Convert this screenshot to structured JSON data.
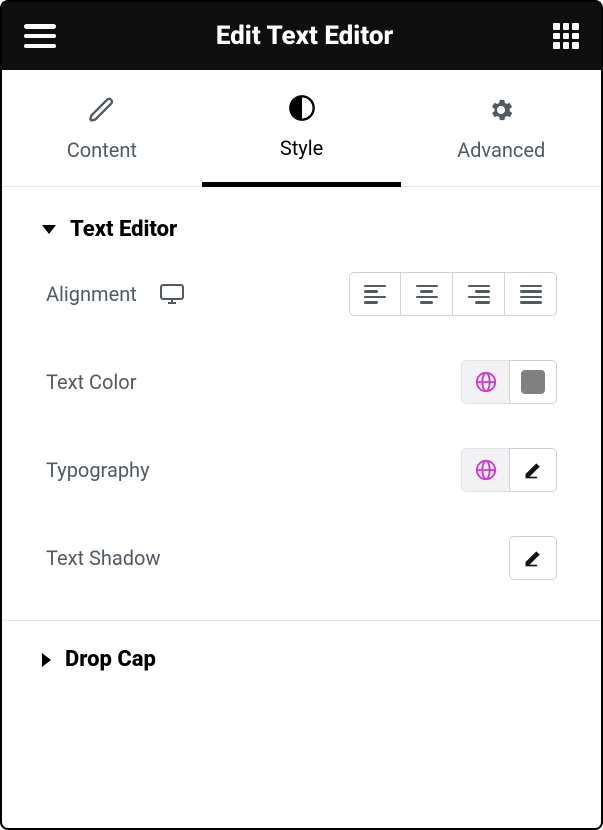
{
  "header": {
    "title": "Edit Text Editor"
  },
  "tabs": [
    {
      "label": "Content"
    },
    {
      "label": "Style"
    },
    {
      "label": "Advanced"
    }
  ],
  "active_tab": 1,
  "sections": {
    "text_editor": {
      "title": "Text Editor",
      "expanded": true,
      "controls": {
        "alignment": {
          "label": "Alignment"
        },
        "text_color": {
          "label": "Text Color",
          "swatch": "#808080",
          "global": true
        },
        "typography": {
          "label": "Typography",
          "global": true
        },
        "text_shadow": {
          "label": "Text Shadow"
        }
      }
    },
    "drop_cap": {
      "title": "Drop Cap",
      "expanded": false
    }
  },
  "colors": {
    "globe": "#d633d6"
  }
}
